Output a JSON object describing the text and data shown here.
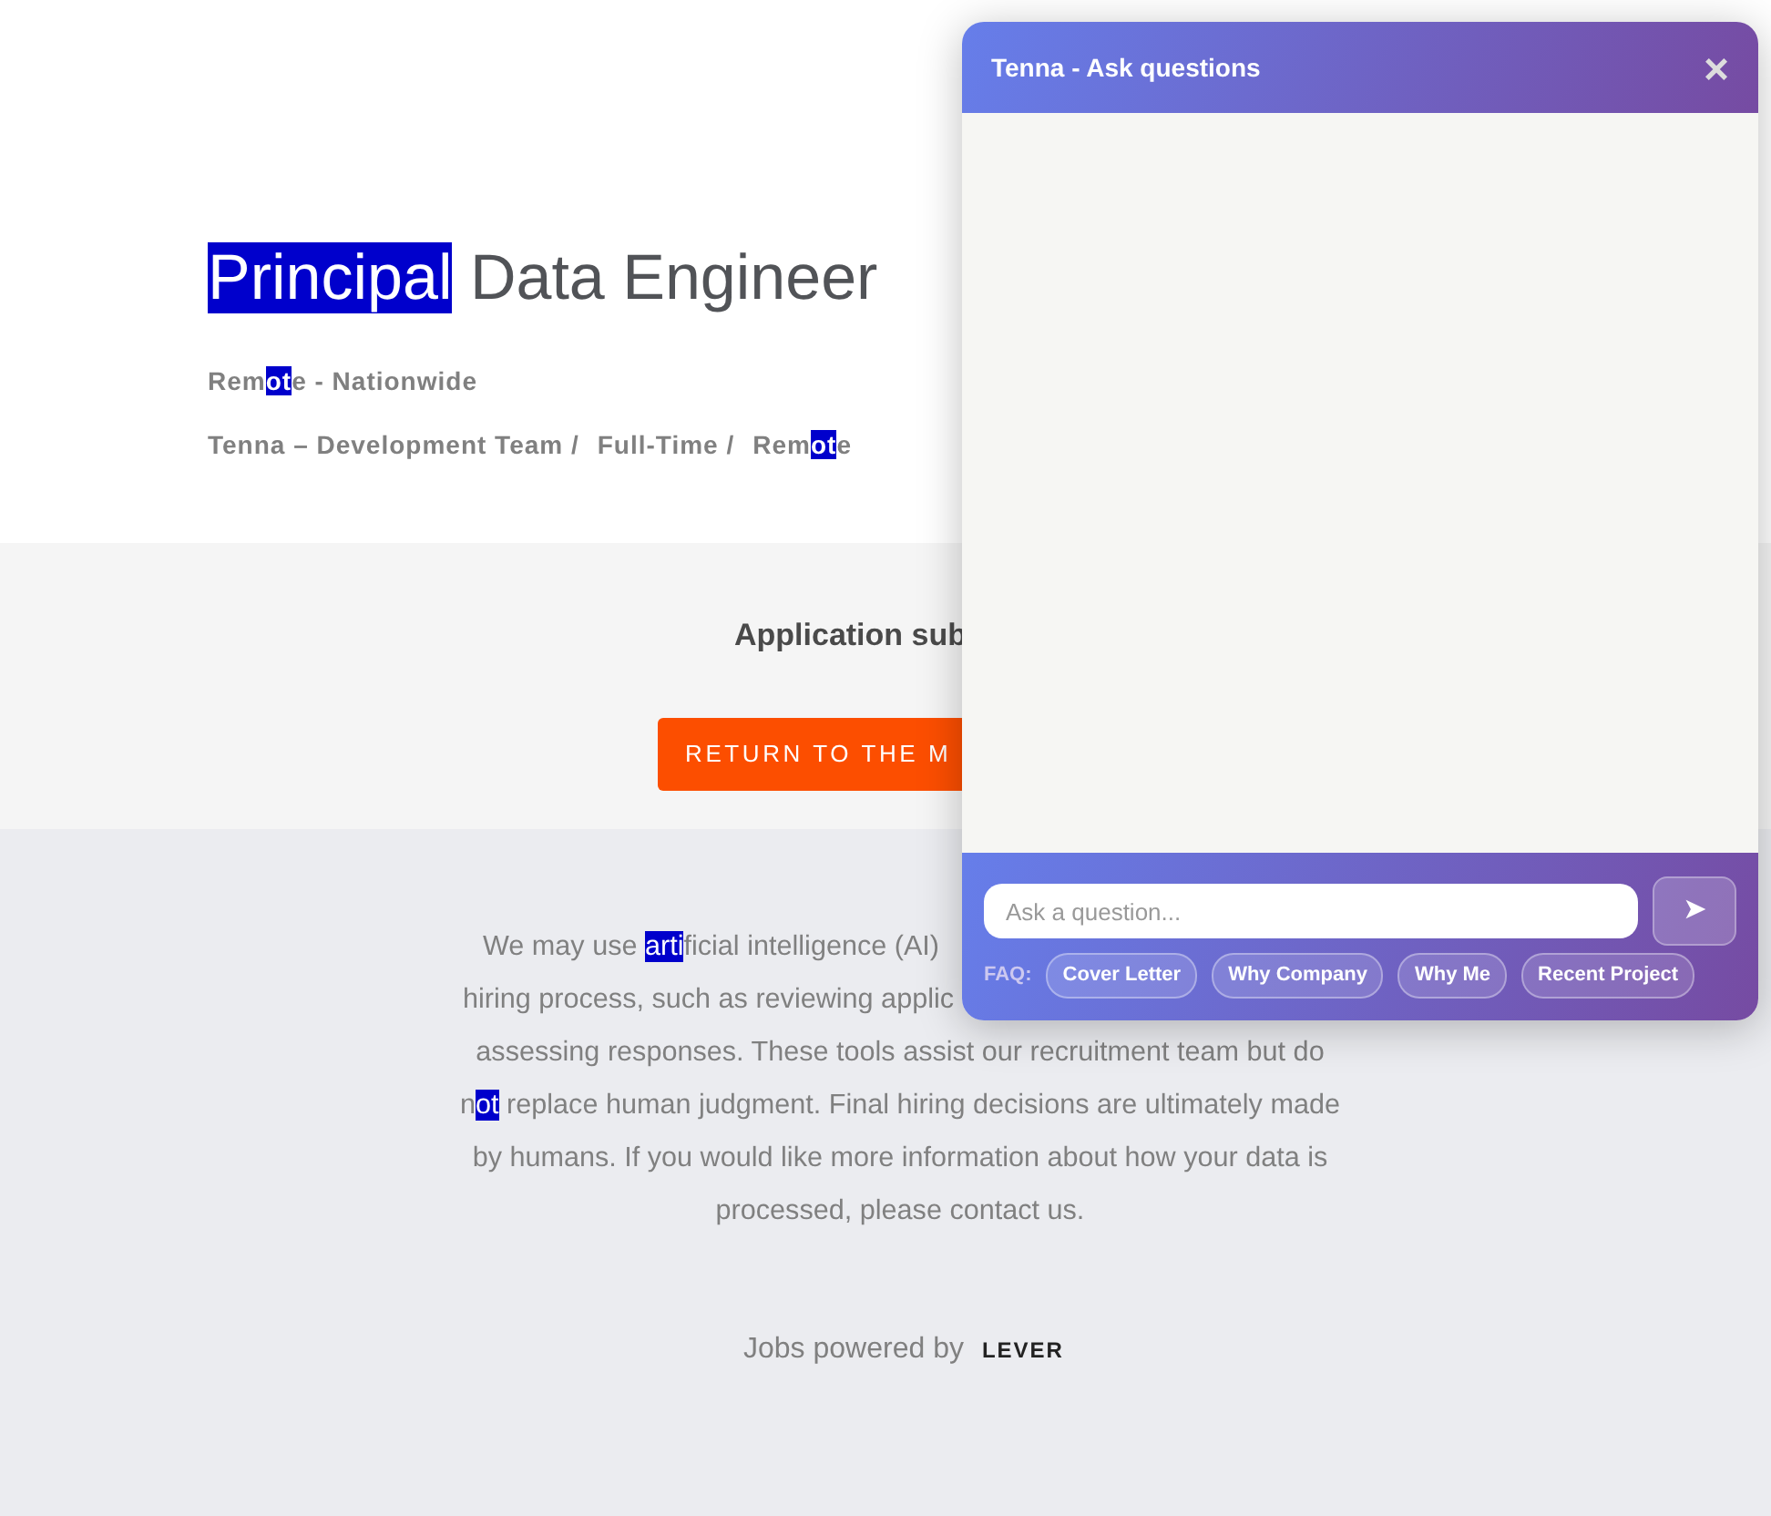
{
  "job": {
    "title": [
      {
        "text": "Principal",
        "highlighted": true
      },
      {
        "text": " Data Engineer",
        "highlighted": false
      }
    ],
    "location": [
      {
        "text": "Rem",
        "highlighted": false
      },
      {
        "text": "ot",
        "highlighted": true
      },
      {
        "text": "e - Nationwide",
        "highlighted": false
      }
    ],
    "categories": [
      [
        {
          "text": "Tenna – Development Team /",
          "highlighted": false
        }
      ],
      [
        {
          "text": "Full-Time /",
          "highlighted": false
        }
      ],
      [
        {
          "text": "Rem",
          "highlighted": false
        },
        {
          "text": "ot",
          "highlighted": true
        },
        {
          "text": "e",
          "highlighted": false
        }
      ]
    ]
  },
  "confirmation": {
    "message": "Application sub",
    "button": "RETURN TO THE M"
  },
  "disclaimer": {
    "lines": [
      [
        {
          "text": "We may use ",
          "highlighted": false
        },
        {
          "text": "arti",
          "highlighted": true
        },
        {
          "text": "ficial intelligence (AI)",
          "highlighted": false
        }
      ],
      [
        {
          "text": "hiring process, such as reviewing applic",
          "highlighted": false
        }
      ],
      [
        {
          "text": "assessing responses. These tools assist our recruitment team but do",
          "highlighted": false
        }
      ],
      [
        {
          "text": "n",
          "highlighted": false
        },
        {
          "text": "ot",
          "highlighted": true
        },
        {
          "text": " replace human judgment. Final hiring decisions are ultimately made",
          "highlighted": false
        }
      ],
      [
        {
          "text": "by humans. If you would like more information about how your data is",
          "highlighted": false
        }
      ],
      [
        {
          "text": "processed, please contact us.",
          "highlighted": false
        }
      ]
    ]
  },
  "footer": {
    "text": "Jobs powered by",
    "logo": "LEVER"
  },
  "chat": {
    "title": "Tenna - Ask questions",
    "close": "×",
    "placeholder": "Ask a question...",
    "send": "➤",
    "faq_label": "FAQ:",
    "faq": [
      "Cover Letter",
      "Why Company",
      "Why Me",
      "Recent Project"
    ]
  }
}
